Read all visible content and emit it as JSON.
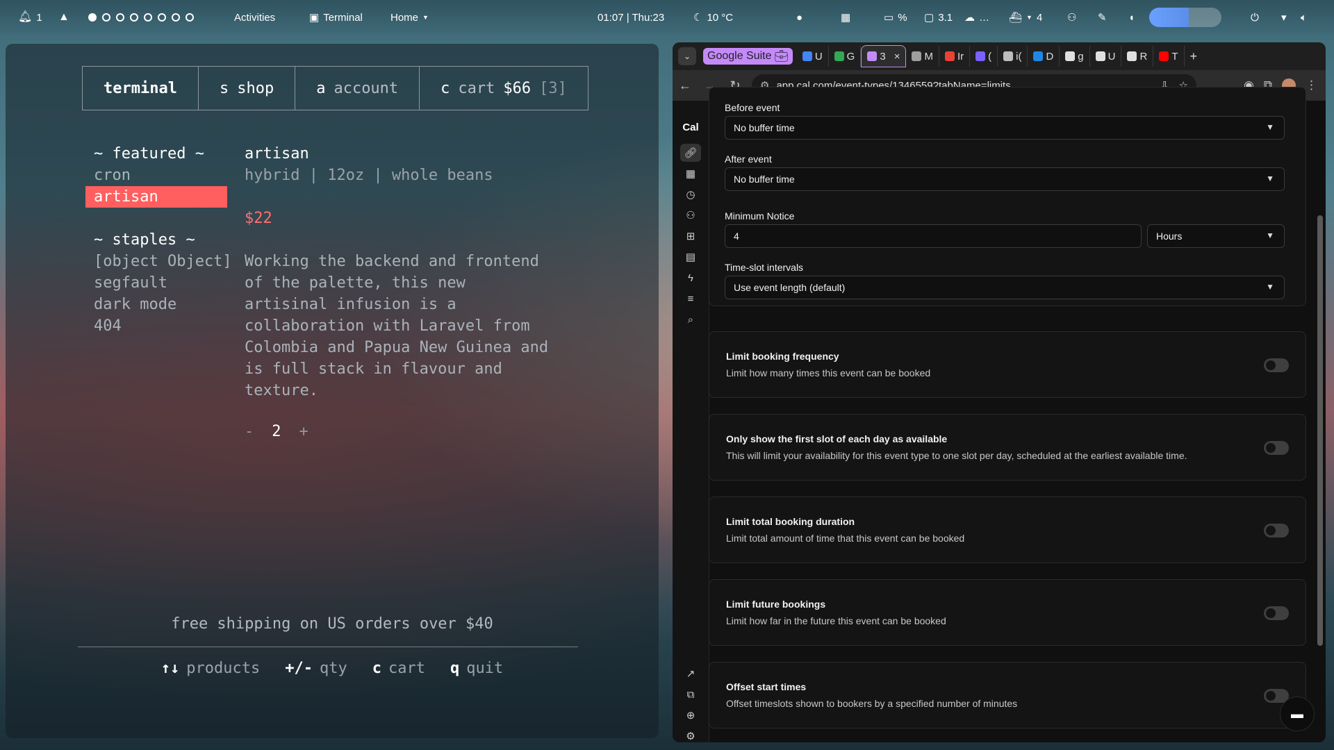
{
  "topbar": {
    "notif_count": "1",
    "activities": "Activities",
    "terminal": "Terminal",
    "home": "Home",
    "clock": "01:07 | Thu:23",
    "weather": "10 °C",
    "battery": "%",
    "displays": "3.1",
    "cloud": "…",
    "docker_count": "4"
  },
  "terminal": {
    "tabs": [
      {
        "key": "",
        "label": "terminal"
      },
      {
        "key": "s",
        "label": "shop"
      },
      {
        "key": "a",
        "label": "account"
      },
      {
        "key": "c",
        "label": "cart",
        "price": "$66",
        "count": "[3]"
      }
    ],
    "featured_header": "~ featured ~",
    "featured": [
      "cron",
      "artisan"
    ],
    "staples_header": "~ staples ~",
    "staples": [
      "[object Object]",
      "segfault",
      "dark mode",
      "404"
    ],
    "product": {
      "name": "artisan",
      "meta": "hybrid | 12oz | whole beans",
      "price": "$22",
      "description": "Working the backend and frontend of the palette, this new artisinal infusion is a collaboration with Laravel from Colombia and Papua New Guinea and is full stack in flavour and texture."
    },
    "qty": {
      "minus": "-",
      "value": "2",
      "plus": "+"
    },
    "shipping": "free shipping on US orders over $40",
    "help": [
      {
        "key": "↑↓",
        "desc": "products"
      },
      {
        "key": "+/-",
        "desc": "qty"
      },
      {
        "key": "c",
        "desc": "cart"
      },
      {
        "key": "q",
        "desc": "quit"
      }
    ]
  },
  "browser": {
    "group_label": "Google Suite",
    "tabs": [
      {
        "label": "U",
        "color": "#4285f4"
      },
      {
        "label": "G",
        "color": "#34a853"
      },
      {
        "label": "3",
        "color": "#c58af9",
        "active": true
      },
      {
        "label": "M",
        "color": "#9e9e9e"
      },
      {
        "label": "Ir",
        "color": "#ea4335"
      },
      {
        "label": "(",
        "color": "#7b61ff"
      },
      {
        "label": "i(",
        "color": "#bdbdbd"
      },
      {
        "label": "D",
        "color": "#1e88e5"
      },
      {
        "label": "g",
        "color": "#e0e0e0"
      },
      {
        "label": "U",
        "color": "#e0e0e0"
      },
      {
        "label": "R",
        "color": "#e0e0e0"
      },
      {
        "label": "T",
        "color": "#ff0000"
      }
    ],
    "url": "app.cal.com/event-types/1346559?tabName=limits"
  },
  "cal": {
    "logo": "Cal",
    "before_event_label": "Before event",
    "before_event_value": "No buffer time",
    "after_event_label": "After event",
    "after_event_value": "No buffer time",
    "min_notice_label": "Minimum Notice",
    "min_notice_value": "4",
    "min_notice_unit": "Hours",
    "slot_label": "Time-slot intervals",
    "slot_value": "Use event length (default)",
    "toggles": [
      {
        "title": "Limit booking frequency",
        "desc": "Limit how many times this event can be booked"
      },
      {
        "title": "Only show the first slot of each day as available",
        "desc": "This will limit your availability for this event type to one slot per day, scheduled at the earliest available time."
      },
      {
        "title": "Limit total booking duration",
        "desc": "Limit total amount of time that this event can be booked"
      },
      {
        "title": "Limit future bookings",
        "desc": "Limit how far in the future this event can be booked"
      },
      {
        "title": "Offset start times",
        "desc": "Offset timeslots shown to bookers by a specified number of minutes"
      }
    ]
  }
}
